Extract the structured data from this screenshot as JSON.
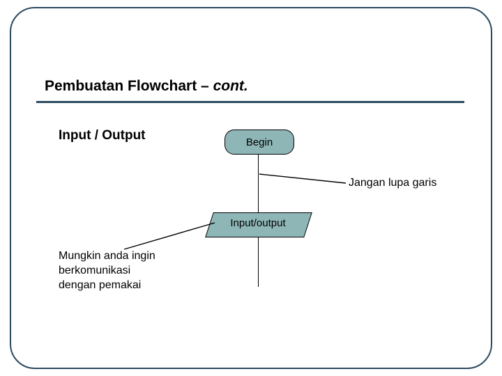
{
  "title": {
    "main": "Pembuatan Flowchart",
    "sep": " – ",
    "suffix": "cont."
  },
  "section_label": "Input / Output",
  "nodes": {
    "begin": "Begin",
    "io": "Input/output"
  },
  "annotations": {
    "right": "Jangan lupa garis",
    "left_line1": "Mungkin anda ingin",
    "left_line2": "berkomunikasi",
    "left_line3": "dengan pemakai"
  }
}
